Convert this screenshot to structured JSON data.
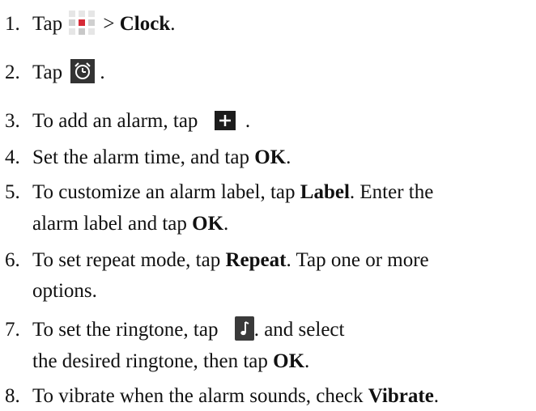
{
  "steps": [
    {
      "num": "1.",
      "pre": "Tap",
      "post": "> ",
      "bold": "Clock",
      "tail": "."
    },
    {
      "num": "2.",
      "pre": "Tap",
      "tail": "."
    },
    {
      "num": "3.",
      "pre": "To add an alarm, tap",
      "tail": "."
    },
    {
      "num": "4.",
      "pre": "Set the alarm time, and tap ",
      "bold": "OK",
      "tail": "."
    },
    {
      "num": "5.",
      "pre": "To customize an alarm label, tap ",
      "bold": "Label",
      "mid": ". Enter the",
      "line2_pre": "alarm label and tap ",
      "line2_bold": "OK",
      "line2_tail": "."
    },
    {
      "num": "6.",
      "pre": "To set repeat mode, tap ",
      "bold": "Repeat",
      "mid": ". Tap one or more",
      "line2_pre": "options."
    },
    {
      "num": "7.",
      "pre": "To set the ringtone, tap",
      "mid": ". and select",
      "line2_pre": " the desired ringtone, then tap ",
      "line2_bold": "OK",
      "line2_tail": "."
    },
    {
      "num": "8.",
      "pre": "To vibrate when the alarm sounds, check ",
      "bold": "Vibrate",
      "tail": "."
    }
  ],
  "icons": {
    "apps": "apps-grid-icon",
    "alarm": "alarm-clock-icon",
    "add": "plus-icon",
    "ringtone": "music-note-icon"
  }
}
